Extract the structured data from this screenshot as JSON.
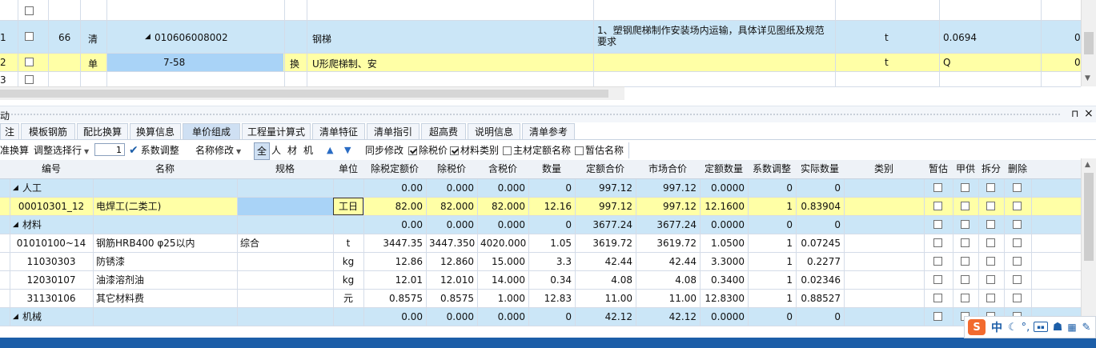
{
  "top_rows": [
    {
      "num": "",
      "col1": "",
      "col2": "",
      "code": "",
      "name": "",
      "feature": "",
      "unit": "",
      "qty": "",
      "last": ""
    },
    {
      "num": "1",
      "col1": "66",
      "col2": "清",
      "code": "010606008002",
      "name": "钢梯",
      "feature": "1、塑钢爬梯制作安装场内运输，具体详见图纸及规范要求",
      "unit": "t",
      "qty": "0.0694",
      "last": "0"
    },
    {
      "num": "2",
      "col1": "",
      "col2": "单",
      "code": "7-58",
      "swap": "换",
      "name": "U形爬梯制、安",
      "feature": "",
      "unit": "t",
      "qty": "Q",
      "last": "0"
    },
    {
      "num": "3",
      "col1": "",
      "col2": "",
      "code": "",
      "name": "",
      "feature": "",
      "unit": "",
      "qty": "",
      "last": ""
    }
  ],
  "panel": {
    "title": "动",
    "pin": "⊓",
    "close": "×"
  },
  "tabs": [
    "注",
    "模板钢筋",
    "配比换算",
    "换算信息",
    "单价组成",
    "工程量计算式",
    "清单特征",
    "清单指引",
    "超高费",
    "说明信息",
    "清单参考"
  ],
  "active_tab": "单价组成",
  "toolbar": {
    "replace": "准换算",
    "adjust_select": "调整选择行",
    "factor_value": "1",
    "factor_adjust": "系数调整",
    "rename": "名称修改",
    "all": "全",
    "labor": "人",
    "material": "材",
    "machine": "机",
    "sync": "同步修改",
    "excl_tax": "除税价",
    "mat_type": "材料类别",
    "main_name": "主材定额名称",
    "temp_name": "暂估名称"
  },
  "headers": [
    "编号",
    "名称",
    "规格",
    "单位",
    "除税定额价",
    "除税价",
    "含税价",
    "数量",
    "定额合价",
    "市场合价",
    "定额数量",
    "系数调整",
    "实际数量",
    "类别",
    "暂估",
    "甲供",
    "拆分",
    "删除"
  ],
  "rows": [
    {
      "type": "group",
      "code": "人工",
      "v1": "0.00",
      "v2": "0.000",
      "v3": "0.000",
      "qty": "0",
      "sum1": "997.12",
      "sum2": "997.12",
      "dq": "0.0000",
      "fac": "0",
      "act": "0"
    },
    {
      "type": "item",
      "hl": true,
      "code": "00010301_12",
      "name": "电焊工(二类工)",
      "spec": "",
      "unit": "工日",
      "v1": "82.00",
      "v2": "82.000",
      "v3": "82.000",
      "qty": "12.16",
      "sum1": "997.12",
      "sum2": "997.12",
      "dq": "12.1600",
      "fac": "1",
      "act": "0.83904"
    },
    {
      "type": "group",
      "code": "材料",
      "v1": "0.00",
      "v2": "0.000",
      "v3": "0.000",
      "qty": "0",
      "sum1": "3677.24",
      "sum2": "3677.24",
      "dq": "0.0000",
      "fac": "0",
      "act": "0"
    },
    {
      "type": "item",
      "code": "01010100~14",
      "name": "钢筋HRB400 φ25以内",
      "spec": "综合",
      "unit": "t",
      "v1": "3447.35",
      "v2": "3447.350",
      "v3": "4020.000",
      "qty": "1.05",
      "sum1": "3619.72",
      "sum2": "3619.72",
      "dq": "1.0500",
      "fac": "1",
      "act": "0.07245"
    },
    {
      "type": "item",
      "code": "11030303",
      "name": "防锈漆",
      "spec": "",
      "unit": "kg",
      "v1": "12.86",
      "v2": "12.860",
      "v3": "15.000",
      "qty": "3.3",
      "sum1": "42.44",
      "sum2": "42.44",
      "dq": "3.3000",
      "fac": "1",
      "act": "0.2277"
    },
    {
      "type": "item",
      "code": "12030107",
      "name": "油漆溶剂油",
      "spec": "",
      "unit": "kg",
      "v1": "12.01",
      "v2": "12.010",
      "v3": "14.000",
      "qty": "0.34",
      "sum1": "4.08",
      "sum2": "4.08",
      "dq": "0.3400",
      "fac": "1",
      "act": "0.02346"
    },
    {
      "type": "item",
      "code": "31130106",
      "name": "其它材料费",
      "spec": "",
      "unit": "元",
      "v1": "0.8575",
      "v2": "0.8575",
      "v3": "1.000",
      "qty": "12.83",
      "sum1": "11.00",
      "sum2": "11.00",
      "dq": "12.8300",
      "fac": "1",
      "act": "0.88527"
    },
    {
      "type": "group",
      "code": "机械",
      "v1": "0.00",
      "v2": "0.000",
      "v3": "0.000",
      "qty": "0",
      "sum1": "42.12",
      "sum2": "42.12",
      "dq": "0.0000",
      "fac": "0",
      "act": "0"
    }
  ],
  "ime": {
    "lang": "中"
  },
  "colors": {
    "row_blue": "#cbe6f7",
    "row_yellow": "#ffffa6",
    "cell_blue": "#a9d3f7",
    "status_blue": "#1c5ea8",
    "tab_active": "#cfe0f3"
  }
}
